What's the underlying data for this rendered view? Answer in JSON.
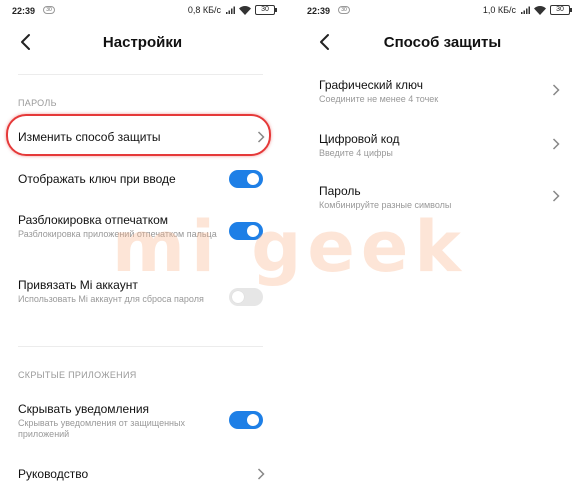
{
  "left": {
    "status": {
      "time": "22:39",
      "badge": "30",
      "speed": "0,8 КБ/с",
      "battery": "30"
    },
    "title": "Настройки",
    "section_password": "ПАРОЛЬ",
    "change_method": "Изменить способ защиты",
    "show_pattern": {
      "title": "Отображать ключ при вводе",
      "toggle": "on"
    },
    "fingerprint": {
      "title": "Разблокировка отпечатком",
      "subtitle": "Разблокировка приложений отпечатком пальца",
      "toggle": "on"
    },
    "mi_account": {
      "title": "Привязать Mi аккаунт",
      "subtitle": "Использовать Mi аккаунт для сброса пароля",
      "toggle": "off"
    },
    "section_hidden": "СКРЫТЫЕ ПРИЛОЖЕНИЯ",
    "hide_notifications": {
      "title": "Скрывать уведомления",
      "subtitle": "Скрывать уведомления от защищенных приложений",
      "toggle": "on"
    },
    "guide": "Руководство"
  },
  "right": {
    "status": {
      "time": "22:39",
      "badge": "30",
      "speed": "1,0 КБ/с",
      "battery": "30"
    },
    "title": "Способ защиты",
    "options": [
      {
        "title": "Графический ключ",
        "subtitle": "Соедините не менее 4 точек"
      },
      {
        "title": "Цифровой код",
        "subtitle": "Введите 4 цифры"
      },
      {
        "title": "Пароль",
        "subtitle": "Комбинируйте разные символы"
      }
    ]
  },
  "watermark": "mi geek",
  "colors": {
    "accent": "#1e7fe6",
    "highlight": "#e53939",
    "watermark": "#f8b48c"
  }
}
